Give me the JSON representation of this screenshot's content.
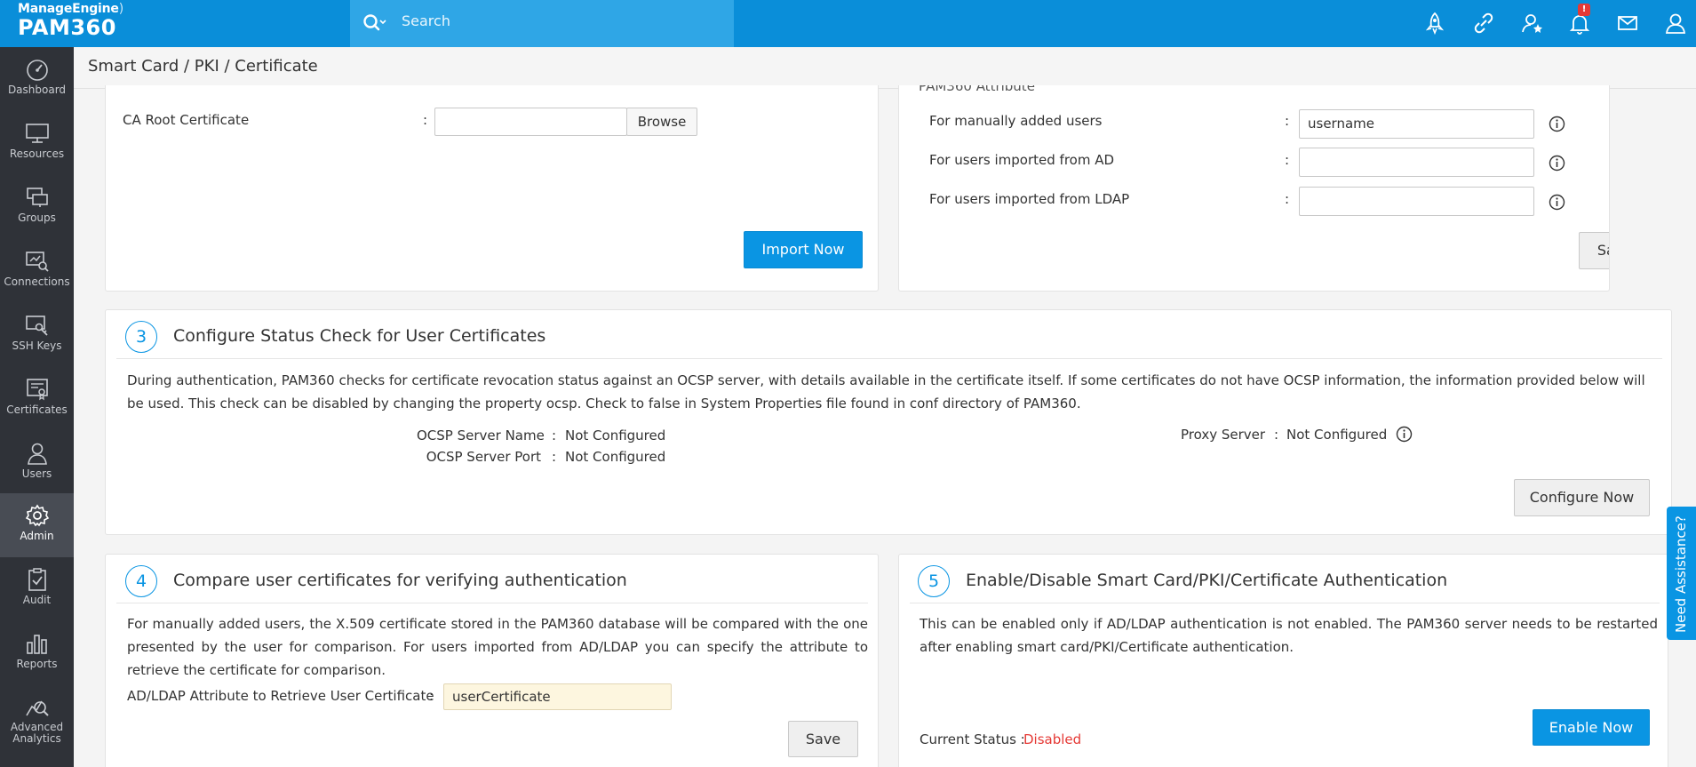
{
  "brand": {
    "vendor": "ManageEngine",
    "product": "PAM360"
  },
  "search": {
    "placeholder": "Search"
  },
  "header_icons": [
    "rocket-icon",
    "link-icon",
    "user-star-icon",
    "bell-icon",
    "mail-icon",
    "user-icon"
  ],
  "notification_badge": "!",
  "sidebar": {
    "items": [
      {
        "label": "Dashboard",
        "icon": "dashboard-icon"
      },
      {
        "label": "Resources",
        "icon": "monitor-icon"
      },
      {
        "label": "Groups",
        "icon": "groups-icon"
      },
      {
        "label": "Connections",
        "icon": "connections-icon"
      },
      {
        "label": "SSH Keys",
        "icon": "ssh-keys-icon"
      },
      {
        "label": "Certificates",
        "icon": "certificates-icon"
      },
      {
        "label": "Users",
        "icon": "users-icon"
      },
      {
        "label": "Admin",
        "icon": "gear-icon",
        "active": true
      },
      {
        "label": "Audit",
        "icon": "audit-icon"
      },
      {
        "label": "Reports",
        "icon": "reports-icon"
      },
      {
        "label": "Advanced Analytics",
        "icon": "analytics-icon"
      }
    ]
  },
  "breadcrumb": "Smart Card / PKI / Certificate",
  "ca_card": {
    "label": "CA Root Certificate",
    "colon": ":",
    "file_value": "",
    "browse_label": "Browse",
    "import_label": "Import Now"
  },
  "attr_card": {
    "partial_title": "PAM360 Attribute",
    "rows": [
      {
        "label": "For manually added users",
        "value": "username"
      },
      {
        "label": "For users imported from AD",
        "value": ""
      },
      {
        "label": "For users imported from LDAP",
        "value": ""
      }
    ],
    "colon": ":",
    "save_label": "Save"
  },
  "section3": {
    "number": "3",
    "title": "Configure Status Check for User Certificates",
    "description": "During authentication, PAM360 checks for certificate revocation status against an OCSP server, with details available in the certificate itself. If some certificates do not have OCSP information, the information provided below will be used. This check can be disabled by changing the property ocsp. Check to false in System Properties file found in conf directory of PAM360.",
    "ocsp_name_label": "OCSP Server Name",
    "ocsp_name_value": "Not Configured",
    "ocsp_port_label": "OCSP Server Port",
    "ocsp_port_value": "Not Configured",
    "proxy_label": "Proxy Server",
    "proxy_value": "Not Configured",
    "colon": ":",
    "configure_label": "Configure Now"
  },
  "section4": {
    "number": "4",
    "title": "Compare user certificates for verifying authentication",
    "description": "For manually added users, the X.509 certificate stored in the PAM360 database will be compared with the one presented by the user for comparison. For users imported from AD/LDAP you can specify the attribute to retrieve the certificate for comparison.",
    "attr_label": "AD/LDAP Attribute to Retrieve User Certificate",
    "colon": ":",
    "attr_value": "userCertificate",
    "save_label": "Save"
  },
  "section5": {
    "number": "5",
    "title": "Enable/Disable Smart Card/PKI/Certificate Authentication",
    "description": "This can be enabled only if AD/LDAP authentication is not enabled. The PAM360 server needs to be restarted after enabling smart card/PKI/Certificate authentication.",
    "status_label": "Current Status :",
    "status_value": "Disabled",
    "enable_label": "Enable Now"
  },
  "assist_label": "Need Assistance?",
  "colors": {
    "topbar": "#0a8ed9",
    "sidebar": "#2f3238",
    "accent": "#0a95e3",
    "disabled": "#e53935"
  }
}
